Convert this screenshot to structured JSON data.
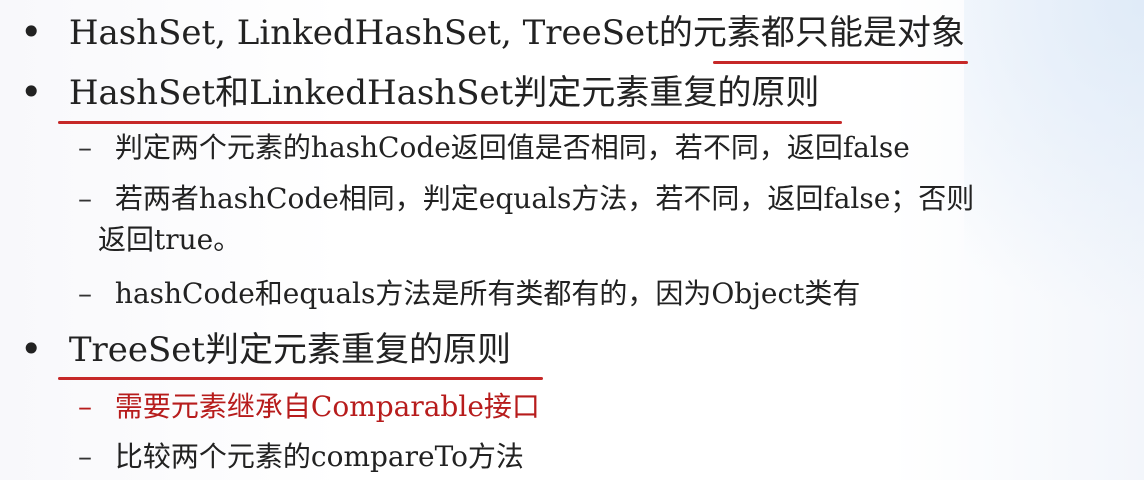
{
  "slide": {
    "bullet_symbol": "•",
    "dash_symbol": "–",
    "items": [
      {
        "text": "HashSet, LinkedHashSet, TreeSet的元素都只能是对象"
      },
      {
        "text": "HashSet和LinkedHashSet判定元素重复的原则",
        "subitems": [
          "判定两个元素的hashCode返回值是否相同，若不同，返回false",
          "若两者hashCode相同，判定equals方法，若不同，返回false；否则",
          "返回true。",
          "hashCode和equals方法是所有类都有的，因为Object类有"
        ]
      },
      {
        "text": "TreeSet判定元素重复的原则",
        "subitems": [
          "需要元素继承自Comparable接口",
          "比较两个元素的compareTo方法"
        ]
      }
    ]
  },
  "colors": {
    "text": "#222222",
    "accent_red": "#b71c1c",
    "underline_red": "#c62828"
  }
}
